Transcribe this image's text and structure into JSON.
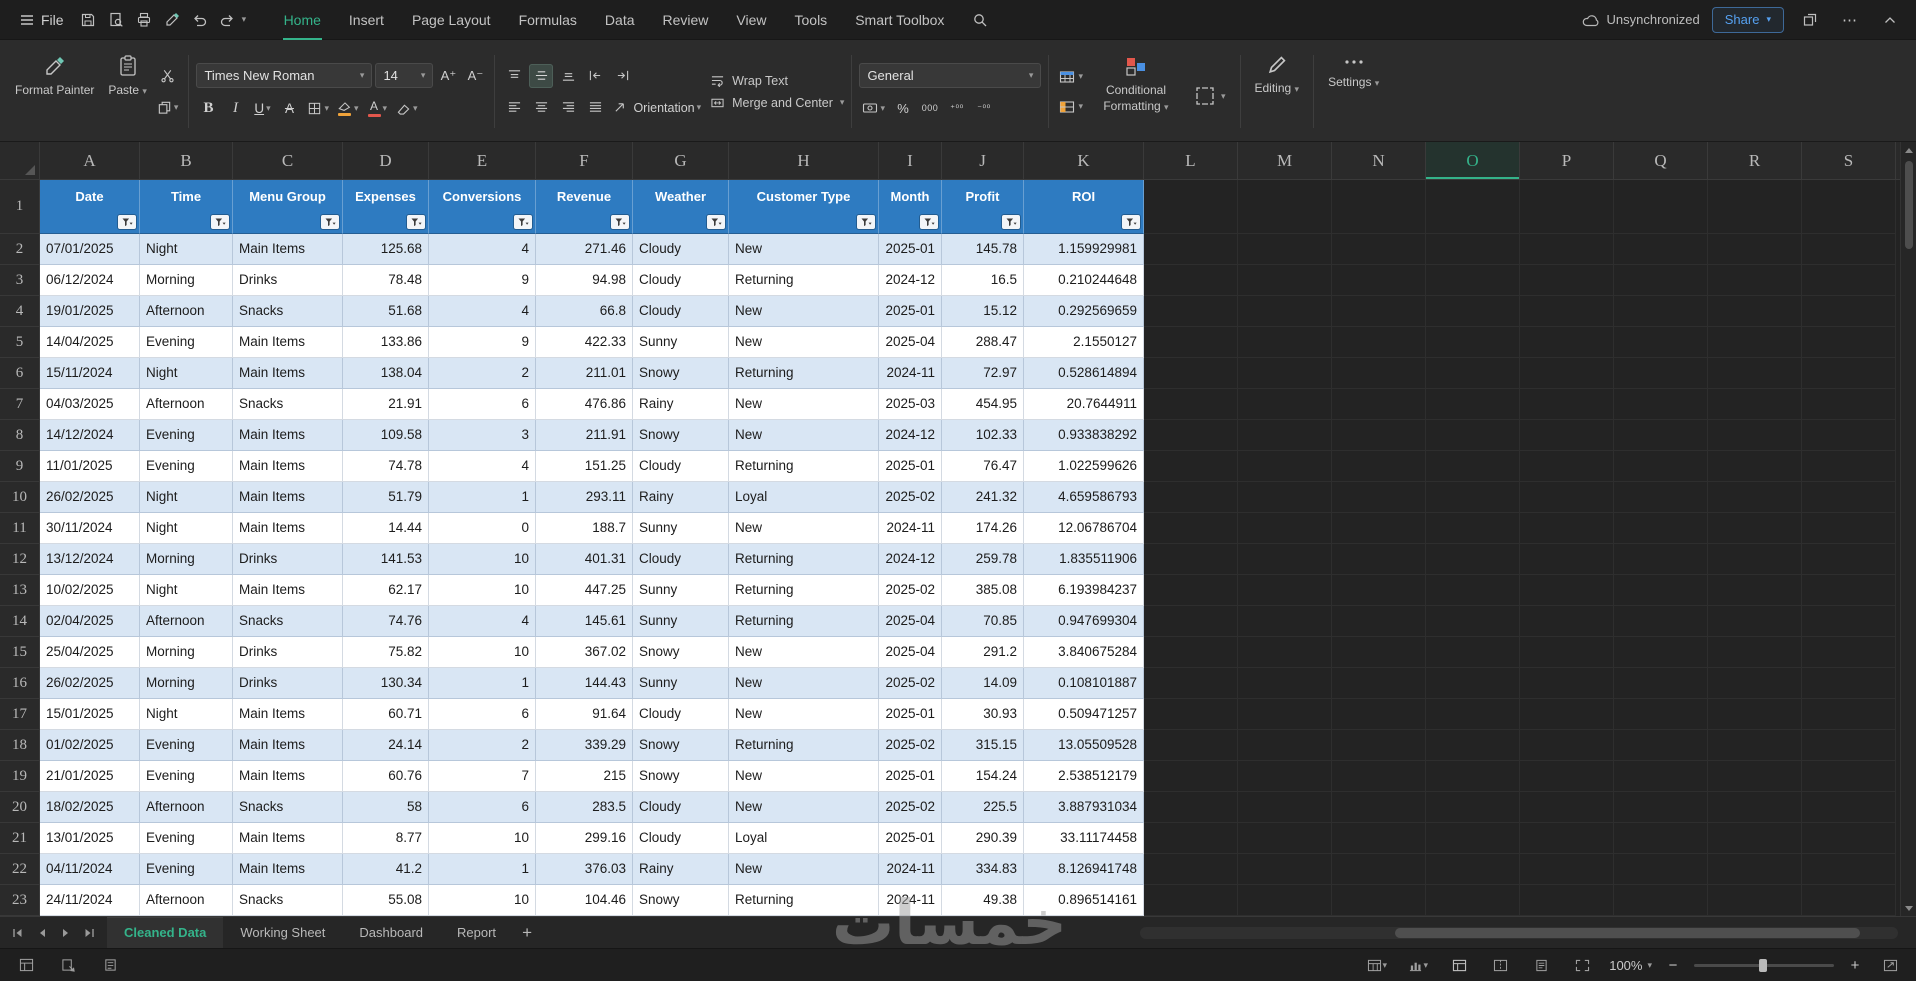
{
  "colors": {
    "accent": "#34b38a",
    "share_blue": "#55a0f0",
    "header_blue": "#2e7bc1",
    "band_blue": "#d9e6f4"
  },
  "titlebar": {
    "file_label": "File",
    "menu_tabs": [
      {
        "label": "Home",
        "active": true
      },
      {
        "label": "Insert",
        "active": false
      },
      {
        "label": "Page Layout",
        "active": false
      },
      {
        "label": "Formulas",
        "active": false
      },
      {
        "label": "Data",
        "active": false
      },
      {
        "label": "Review",
        "active": false
      },
      {
        "label": "View",
        "active": false
      },
      {
        "label": "Tools",
        "active": false
      },
      {
        "label": "Smart Toolbox",
        "active": false
      }
    ],
    "sync_status": "Unsynchronized",
    "share_label": "Share"
  },
  "ribbon": {
    "format_painter": "Format Painter",
    "paste": "Paste",
    "font_name": "Times New Roman",
    "font_size": "14",
    "orientation": "Orientation",
    "wrap_text": "Wrap Text",
    "merge_center": "Merge and Center",
    "number_format": "General",
    "conditional_formatting": "Conditional Formatting",
    "editing": "Editing",
    "settings": "Settings",
    "glyphs": {
      "bold": "B",
      "italic": "I",
      "underline": "U",
      "strike": "A",
      "inc_font": "A⁺",
      "dec_font": "A⁻",
      "percent": "%",
      "thousand": "000",
      "inc_decimal": "⁺⁰⁰",
      "dec_decimal": "⁻⁰⁰"
    }
  },
  "grid": {
    "columns": [
      "A",
      "B",
      "C",
      "D",
      "E",
      "F",
      "G",
      "H",
      "I",
      "J",
      "K",
      "L",
      "M",
      "N",
      "O",
      "P",
      "Q",
      "R",
      "S"
    ],
    "selected_column": "O",
    "first_data_row": 2,
    "headers": [
      "Date",
      "Time",
      "Menu Group",
      "Expenses",
      "Conversions",
      "Revenue",
      "Weather",
      "Customer Type",
      "Month",
      "Profit",
      "ROI"
    ],
    "data": [
      [
        "07/01/2025",
        "Night",
        "Main Items",
        "125.68",
        "4",
        "271.46",
        "Cloudy",
        "New",
        "2025-01",
        "145.78",
        "1.159929981"
      ],
      [
        "06/12/2024",
        "Morning",
        "Drinks",
        "78.48",
        "9",
        "94.98",
        "Cloudy",
        "Returning",
        "2024-12",
        "16.5",
        "0.210244648"
      ],
      [
        "19/01/2025",
        "Afternoon",
        "Snacks",
        "51.68",
        "4",
        "66.8",
        "Cloudy",
        "New",
        "2025-01",
        "15.12",
        "0.292569659"
      ],
      [
        "14/04/2025",
        "Evening",
        "Main Items",
        "133.86",
        "9",
        "422.33",
        "Sunny",
        "New",
        "2025-04",
        "288.47",
        "2.1550127"
      ],
      [
        "15/11/2024",
        "Night",
        "Main Items",
        "138.04",
        "2",
        "211.01",
        "Snowy",
        "Returning",
        "2024-11",
        "72.97",
        "0.528614894"
      ],
      [
        "04/03/2025",
        "Afternoon",
        "Snacks",
        "21.91",
        "6",
        "476.86",
        "Rainy",
        "New",
        "2025-03",
        "454.95",
        "20.7644911"
      ],
      [
        "14/12/2024",
        "Evening",
        "Main Items",
        "109.58",
        "3",
        "211.91",
        "Snowy",
        "New",
        "2024-12",
        "102.33",
        "0.933838292"
      ],
      [
        "11/01/2025",
        "Evening",
        "Main Items",
        "74.78",
        "4",
        "151.25",
        "Cloudy",
        "Returning",
        "2025-01",
        "76.47",
        "1.022599626"
      ],
      [
        "26/02/2025",
        "Night",
        "Main Items",
        "51.79",
        "1",
        "293.11",
        "Rainy",
        "Loyal",
        "2025-02",
        "241.32",
        "4.659586793"
      ],
      [
        "30/11/2024",
        "Night",
        "Main Items",
        "14.44",
        "0",
        "188.7",
        "Sunny",
        "New",
        "2024-11",
        "174.26",
        "12.06786704"
      ],
      [
        "13/12/2024",
        "Morning",
        "Drinks",
        "141.53",
        "10",
        "401.31",
        "Cloudy",
        "Returning",
        "2024-12",
        "259.78",
        "1.835511906"
      ],
      [
        "10/02/2025",
        "Night",
        "Main Items",
        "62.17",
        "10",
        "447.25",
        "Sunny",
        "Returning",
        "2025-02",
        "385.08",
        "6.193984237"
      ],
      [
        "02/04/2025",
        "Afternoon",
        "Snacks",
        "74.76",
        "4",
        "145.61",
        "Sunny",
        "Returning",
        "2025-04",
        "70.85",
        "0.947699304"
      ],
      [
        "25/04/2025",
        "Morning",
        "Drinks",
        "75.82",
        "10",
        "367.02",
        "Snowy",
        "New",
        "2025-04",
        "291.2",
        "3.840675284"
      ],
      [
        "26/02/2025",
        "Morning",
        "Drinks",
        "130.34",
        "1",
        "144.43",
        "Sunny",
        "New",
        "2025-02",
        "14.09",
        "0.108101887"
      ],
      [
        "15/01/2025",
        "Night",
        "Main Items",
        "60.71",
        "6",
        "91.64",
        "Cloudy",
        "New",
        "2025-01",
        "30.93",
        "0.509471257"
      ],
      [
        "01/02/2025",
        "Evening",
        "Main Items",
        "24.14",
        "2",
        "339.29",
        "Snowy",
        "Returning",
        "2025-02",
        "315.15",
        "13.05509528"
      ],
      [
        "21/01/2025",
        "Evening",
        "Main Items",
        "60.76",
        "7",
        "215",
        "Snowy",
        "New",
        "2025-01",
        "154.24",
        "2.538512179"
      ],
      [
        "18/02/2025",
        "Afternoon",
        "Snacks",
        "58",
        "6",
        "283.5",
        "Cloudy",
        "New",
        "2025-02",
        "225.5",
        "3.887931034"
      ],
      [
        "13/01/2025",
        "Evening",
        "Main Items",
        "8.77",
        "10",
        "299.16",
        "Cloudy",
        "Loyal",
        "2025-01",
        "290.39",
        "33.11174458"
      ],
      [
        "04/11/2024",
        "Evening",
        "Main Items",
        "41.2",
        "1",
        "376.03",
        "Rainy",
        "New",
        "2024-11",
        "334.83",
        "8.126941748"
      ],
      [
        "24/11/2024",
        "Afternoon",
        "Snacks",
        "55.08",
        "10",
        "104.46",
        "Snowy",
        "Returning",
        "2024-11",
        "49.38",
        "0.896514161"
      ]
    ]
  },
  "sheetbar": {
    "tabs": [
      {
        "label": "Cleaned Data",
        "active": true
      },
      {
        "label": "Working Sheet",
        "active": false
      },
      {
        "label": "Dashboard",
        "active": false
      },
      {
        "label": "Report",
        "active": false
      }
    ],
    "add_label": "+"
  },
  "statusbar": {
    "zoom": "100%",
    "zoom_out": "−",
    "zoom_in": "+"
  },
  "watermark": {
    "text": "خمسات"
  }
}
